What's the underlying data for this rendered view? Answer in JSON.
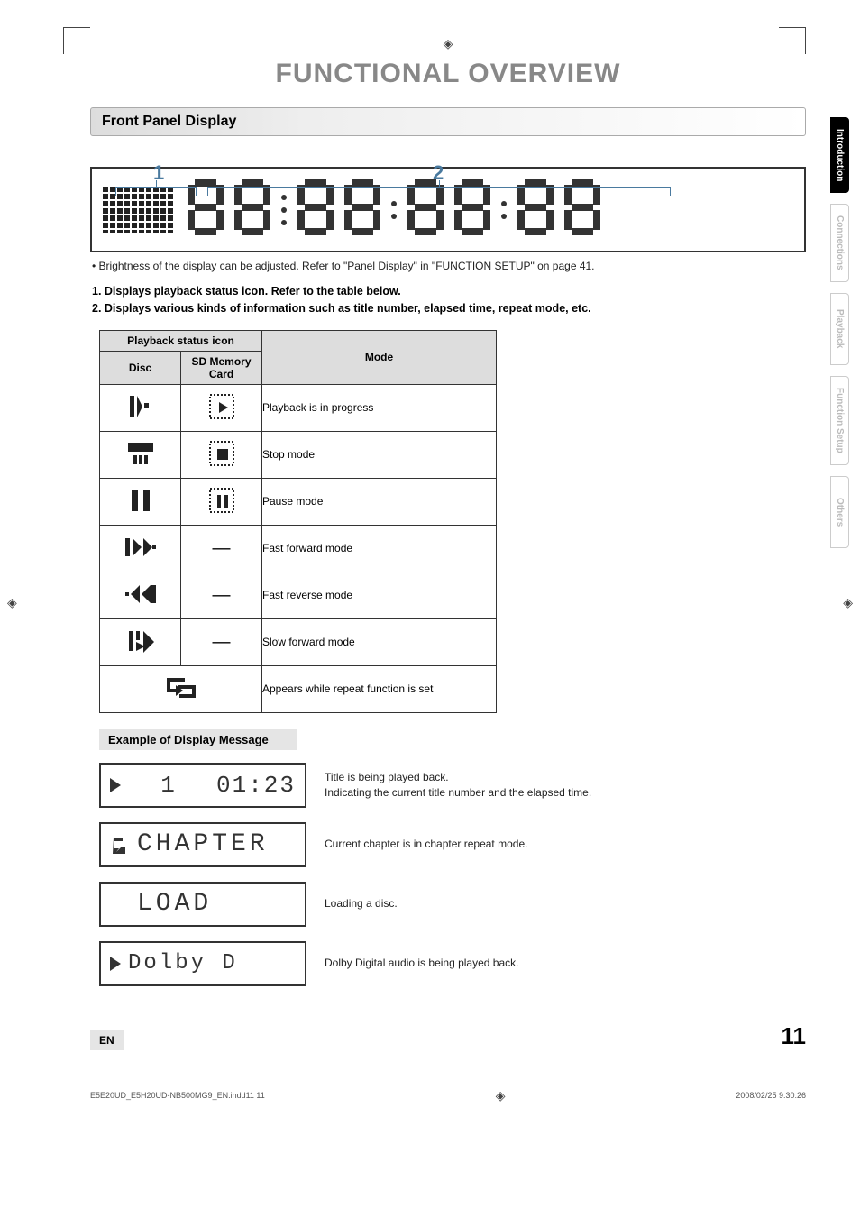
{
  "topMarker": "◈",
  "mainTitle": "FUNCTIONAL OVERVIEW",
  "sectionHeader": "Front Panel Display",
  "numLabels": {
    "one": "1",
    "two": "2"
  },
  "note": "• Brightness of the display can be adjusted. Refer to \"Panel Display\" in \"FUNCTION SETUP\" on page 41.",
  "boldList1": "1.   Displays playback status icon. Refer to the table below.",
  "boldList2": "2.   Displays various kinds of information such as title number, elapsed time, repeat mode, etc.",
  "table": {
    "headers": {
      "iconSpan": "Playback status icon",
      "disc": "Disc",
      "sd": "SD Memory Card",
      "mode": "Mode"
    },
    "rows": [
      {
        "mode": "Playback is in progress",
        "sdHasIcon": true
      },
      {
        "mode": "Stop mode",
        "sdHasIcon": true
      },
      {
        "mode": "Pause mode",
        "sdHasIcon": true
      },
      {
        "mode": "Fast forward mode",
        "sdHasIcon": false
      },
      {
        "mode": "Fast reverse mode",
        "sdHasIcon": false
      },
      {
        "mode": "Slow forward mode",
        "sdHasIcon": false
      }
    ],
    "repeatRow": "Appears while repeat function is set"
  },
  "subHeader": "Example of Display Message",
  "examples": [
    {
      "disp": {
        "icon": "play",
        "text1": "1",
        "text2": "01:23"
      },
      "desc": "Title is being played back.\nIndicating the current title number and the elapsed time."
    },
    {
      "disp": {
        "icon": "repeat",
        "text": "CHAPTER"
      },
      "desc": "Current chapter is in chapter repeat mode."
    },
    {
      "disp": {
        "icon": "",
        "text": "LOAD"
      },
      "desc": "Loading a disc."
    },
    {
      "disp": {
        "icon": "play",
        "text": "Dolby D"
      },
      "desc": "Dolby Digital audio is being played back."
    }
  ],
  "sideTabs": [
    "Introduction",
    "Connections",
    "Playback",
    "Function Setup",
    "Others"
  ],
  "footer": {
    "en": "EN",
    "page": "11"
  },
  "bottomBar": {
    "left": "E5E20UD_E5H20UD-NB500MG9_EN.indd11   11",
    "mid": "◈",
    "right": "2008/02/25   9:30:26"
  }
}
